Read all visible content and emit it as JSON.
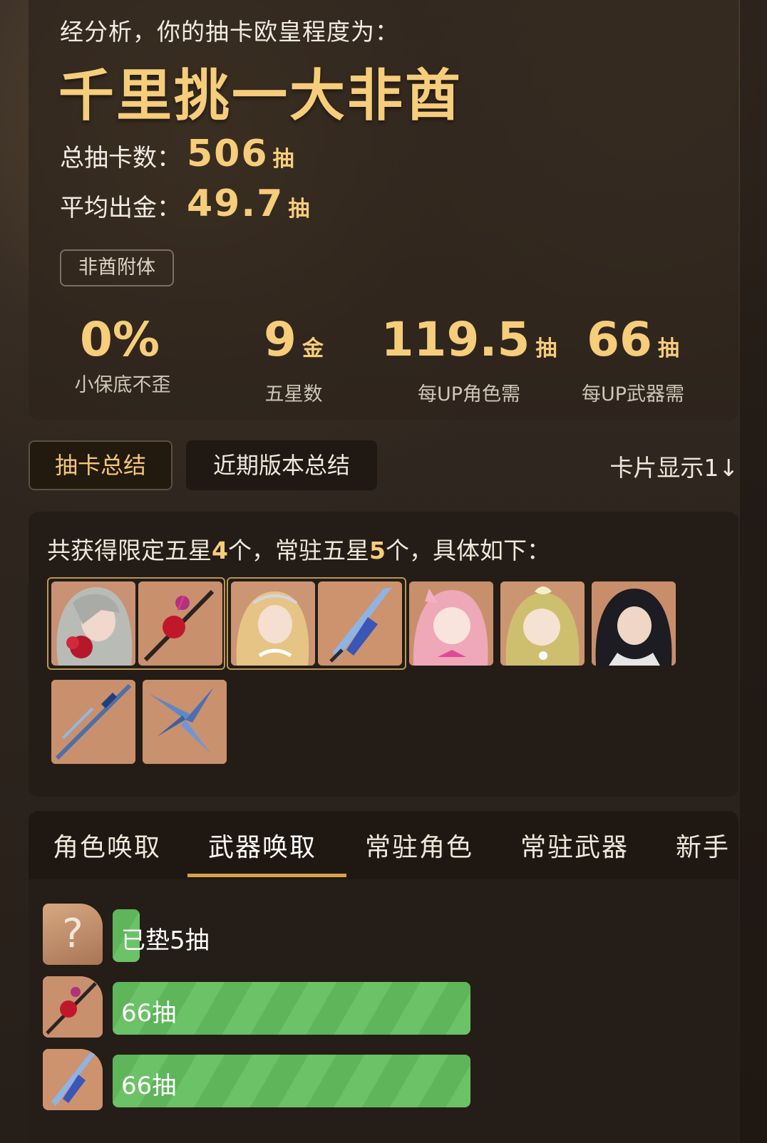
{
  "summary": {
    "intro": "经分析，你的抽卡欧皇程度为：",
    "verdict": "千里挑一大非酋",
    "total_label": "总抽卡数：",
    "total_value": "506",
    "total_unit": "抽",
    "avg_label": "平均出金：",
    "avg_value": "49.7",
    "avg_unit": "抽",
    "tag": "非酋附体",
    "metrics": [
      {
        "value": "0%",
        "unit": "",
        "label": "小保底不歪"
      },
      {
        "value": "9",
        "unit": "金",
        "label": "五星数"
      },
      {
        "value": "119.5",
        "unit": "抽",
        "label": "每UP角色需"
      },
      {
        "value": "66",
        "unit": "抽",
        "label": "每UP武器需"
      }
    ]
  },
  "tabs": {
    "summary": "抽卡总结",
    "recent": "近期版本总结",
    "card_display": "卡片显示1↓"
  },
  "cards": {
    "prefix": "共获得限定五星",
    "limited_count": "4",
    "middle": "个，常驻五星",
    "standard_count": "5",
    "suffix": "个，具体如下：",
    "items": [
      "character-silver-hair-red-flower",
      "weapon-red-flower-sword",
      "character-blonde-crown",
      "weapon-blue-crystal-sword",
      "character-pink-hair",
      "character-green-hair",
      "character-black-hair",
      "weapon-blue-spear",
      "weapon-blue-shuriken"
    ]
  },
  "pool": {
    "tabs": [
      "角色唤取",
      "武器唤取",
      "常驻角色",
      "常驻武器",
      "新手"
    ],
    "selected": 1,
    "rows": [
      {
        "text": "已垫5抽",
        "thumb": "question-mark",
        "pulls": 5
      },
      {
        "text": "66抽",
        "thumb": "weapon-red-flower-sword",
        "pulls": 66
      },
      {
        "text": "66抽",
        "thumb": "weapon-blue-crystal-sword",
        "pulls": 66
      }
    ],
    "unknown_glyph": "?"
  },
  "colors": {
    "gold": "#f6cd7a",
    "bar_green": "#5fb55a",
    "tab_underline": "#d8a24a",
    "card_border": "#b89656"
  }
}
